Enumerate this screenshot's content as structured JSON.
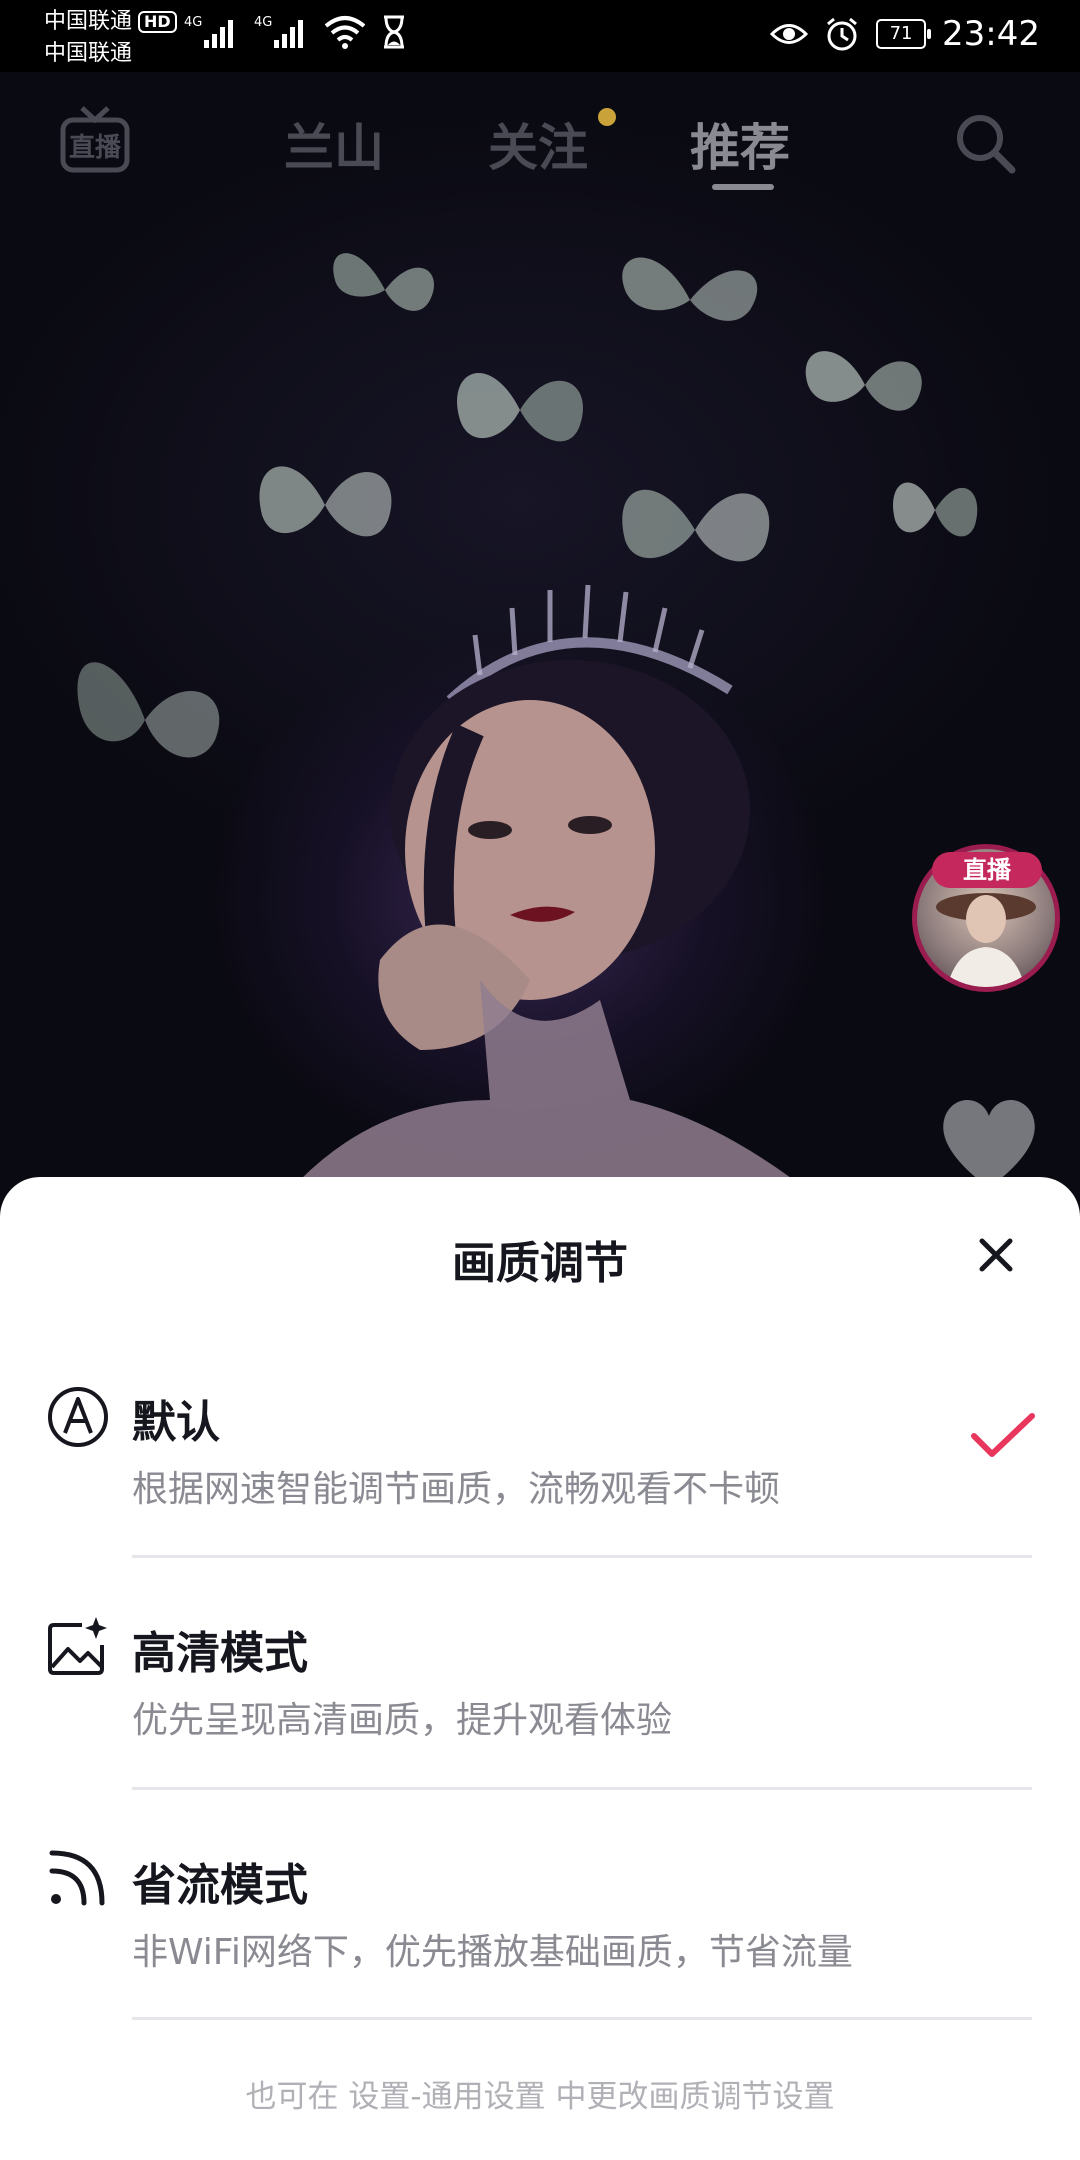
{
  "status_bar": {
    "carrier_1": "中国联通",
    "hd_badge": "HD",
    "carrier_2": "中国联通",
    "network_1": "4G",
    "network_2": "4G",
    "battery": "71",
    "time": "23:42"
  },
  "top_nav": {
    "live_label": "直播",
    "tabs": [
      {
        "label": "兰山"
      },
      {
        "label": "关注"
      },
      {
        "label": "推荐"
      }
    ],
    "active_tab": "推荐"
  },
  "side": {
    "live_badge": "直播"
  },
  "sheet": {
    "title": "画质调节",
    "options": [
      {
        "title": "默认",
        "desc": "根据网速智能调节画质，流畅观看不卡顿",
        "selected": true
      },
      {
        "title": "高清模式",
        "desc": "优先呈现高清画质，提升观看体验",
        "selected": false
      },
      {
        "title": "省流模式",
        "desc": "非WiFi网络下，优先播放基础画质，节省流量",
        "selected": false
      }
    ],
    "footer": "也可在 设置-通用设置 中更改画质调节设置"
  },
  "colors": {
    "accent": "#e8365d",
    "sheet_bg": "#ffffff",
    "muted_text": "#8a8a92"
  }
}
